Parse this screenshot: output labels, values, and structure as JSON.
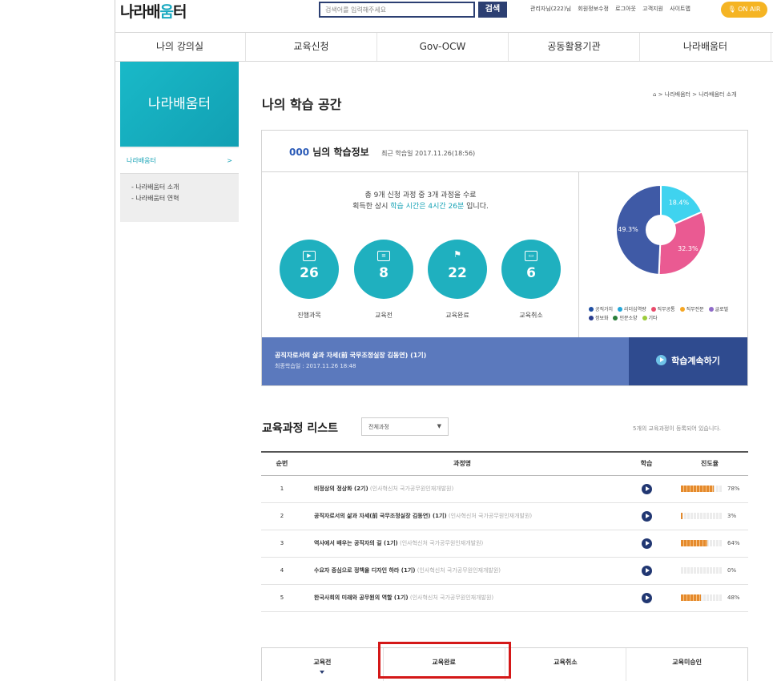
{
  "header": {
    "logo_part1": "나라배",
    "logo_part2": "움",
    "logo_part3": "터",
    "search_placeholder": "검색어를 입력해주세요",
    "search_button": "검색",
    "util_links": [
      "관리자님(222)님",
      "회원정보수정",
      "로그아웃",
      "고객지원",
      "사이트맵"
    ],
    "onair_label": "ON AIR"
  },
  "gnb": [
    "나의 강의실",
    "교육신청",
    "Gov-OCW",
    "공동활용기관",
    "나라배움터"
  ],
  "lnb": {
    "title": "나라배움터",
    "active_item": "나라배움터",
    "active_arrow": ">",
    "sub_items": [
      "- 나라배움터 소개",
      "- 나라배움터 연혁"
    ]
  },
  "page": {
    "title": "나의 학습 공간",
    "breadcrumb": "⌂ > 나라배움터 > 나라배움터 소개"
  },
  "info": {
    "user_name": "000",
    "title_suffix": " 님의 학습정보",
    "last_study": "최근 학습일 2017.11.26(18:56)",
    "summary_line1": "총 9개 신청 과정 중 3개 과정을 수료",
    "summary_line2_prefix": "획득한 상시 ",
    "summary_line2_highlight": "학습 시간은 4시간 26분",
    "summary_line2_suffix": " 입니다.",
    "stats": [
      {
        "icon": "play-doc-icon",
        "value": "26",
        "label": "진행과목"
      },
      {
        "icon": "list-doc-icon",
        "value": "8",
        "label": "교육전"
      },
      {
        "icon": "flag-icon",
        "value": "22",
        "label": "교육완료"
      },
      {
        "icon": "monitor-icon",
        "value": "6",
        "label": "교육취소"
      }
    ],
    "recent_course": "공직자로서의 삶과 자세(前 국무조정실장 김동연) (1기)",
    "recent_date": "최종학습일 : 2017.11.26 18:48",
    "continue_button": "학습계속하기"
  },
  "chart_data": {
    "type": "pie",
    "slices": [
      {
        "label": "",
        "value": 18.4,
        "color": "#3fd3ef"
      },
      {
        "label": "",
        "value": 32.3,
        "color": "#ea5a92"
      },
      {
        "label": "",
        "value": 49.3,
        "color": "#3f5aa6"
      }
    ],
    "slice_labels": [
      "18.4%",
      "32.3%",
      "49.3%"
    ],
    "legend": [
      {
        "label": "공직가치",
        "color": "#1f4fa3"
      },
      {
        "label": "리더십역량",
        "color": "#22a6d8"
      },
      {
        "label": "직무공통",
        "color": "#e94b6b"
      },
      {
        "label": "직무전문",
        "color": "#f5a623"
      },
      {
        "label": "글로벌",
        "color": "#8f6bc9"
      },
      {
        "label": "정보화",
        "color": "#2a3d8f"
      },
      {
        "label": "인문소양",
        "color": "#2a7f3a"
      },
      {
        "label": "기타",
        "color": "#9ccc3a"
      }
    ]
  },
  "list": {
    "title": "교육과정 리스트",
    "select_value": "전체과정",
    "count_text": "5개의 교육과정이 등록되어 있습니다.",
    "headers": [
      "순번",
      "과정명",
      "학습",
      "진도율"
    ],
    "rows": [
      {
        "no": "1",
        "title": "비정상의 정상화 (2기)",
        "org": " (인사혁신처 국가공무원인재개발원)",
        "progress": 78,
        "pct": "78%"
      },
      {
        "no": "2",
        "title": "공직자로서의 삶과 자세(前 국무조정실장 김동연) (1기)",
        "org": " (인사혁신처 국가공무원인재개발원)",
        "progress": 3,
        "pct": "3%"
      },
      {
        "no": "3",
        "title": "역사에서 배우는 공직자의 길 (1기)",
        "org": " (인사혁신처 국가공무원인재개발원)",
        "progress": 64,
        "pct": "64%"
      },
      {
        "no": "4",
        "title": "수요자 중심으로 정책을 디자인 하라 (1기)",
        "org": " (인사혁신처 국가공무원인재개발원)",
        "progress": 0,
        "pct": "0%"
      },
      {
        "no": "5",
        "title": "한국사회의 미래와 공무원의 역할 (1기)",
        "org": " (인사혁신처 국가공무원인재개발원)",
        "progress": 48,
        "pct": "48%"
      }
    ]
  },
  "tabs": [
    "교육전",
    "교육완료",
    "교육취소",
    "교육미승인"
  ]
}
